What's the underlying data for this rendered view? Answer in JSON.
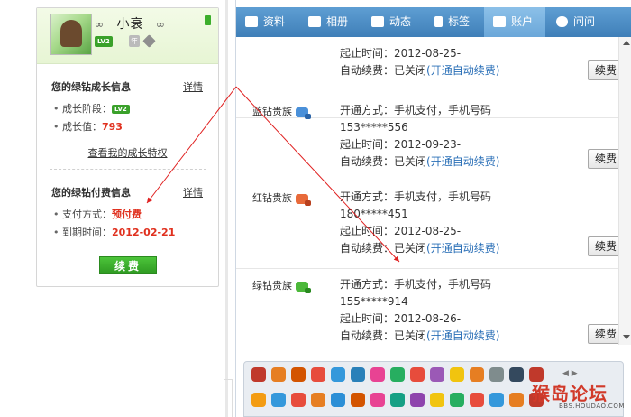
{
  "profile": {
    "nickname": "小衰",
    "nick_symbol": "∞",
    "level_badge": "LV2",
    "year_badge": "年"
  },
  "growth": {
    "title": "您的绿钻成长信息",
    "detail_link": "详情",
    "stage_label": "成长阶段：",
    "stage_badge": "LV2",
    "value_label": "成长值：",
    "value": "793",
    "privilege_link": "查看我的成长特权"
  },
  "payment": {
    "title": "您的绿钻付费信息",
    "detail_link": "详情",
    "method_label": "支付方式：",
    "method_value": "预付费",
    "expire_label": "到期时间：",
    "expire_value": "2012-02-21",
    "renew_button": "续费"
  },
  "tabs": [
    {
      "label": "资料",
      "icon": "id-card-icon"
    },
    {
      "label": "相册",
      "icon": "photo-album-icon"
    },
    {
      "label": "动态",
      "icon": "news-feed-icon"
    },
    {
      "label": "标签",
      "icon": "tag-icon"
    },
    {
      "label": "账户",
      "icon": "account-icon",
      "active": true
    },
    {
      "label": "问问",
      "icon": "question-icon"
    }
  ],
  "top_partial": {
    "masked_line": "--- ---",
    "period_label": "起止时间：",
    "period_value": "2012-08-25-",
    "auto_label": "自动续费：",
    "auto_value": "已关闭",
    "auto_link": "(开通自动续费)",
    "button": "续费"
  },
  "services": [
    {
      "name": "蓝钻贵族",
      "color": "blue",
      "open_label": "开通方式：",
      "open_value": "手机支付，手机号码",
      "phone": "153*****556",
      "period_label": "起止时间：",
      "period_value": "2012-09-23-",
      "auto_label": "自动续费：",
      "auto_value": "已关闭",
      "auto_link": "(开通自动续费)",
      "button": "续费"
    },
    {
      "name": "红钻贵族",
      "color": "red",
      "open_label": "开通方式：",
      "open_value": "手机支付，手机号码",
      "phone": "180*****451",
      "period_label": "起止时间：",
      "period_value": "2012-08-25-",
      "auto_label": "自动续费：",
      "auto_value": "已关闭",
      "auto_link": "(开通自动续费)",
      "button": "续费"
    },
    {
      "name": "绿钻贵族",
      "color": "green",
      "open_label": "开通方式：",
      "open_value": "手机支付，手机号码",
      "phone": "155*****914",
      "period_label": "起止时间：",
      "period_value": "2012-08-26-",
      "auto_label": "自动续费：",
      "auto_value": "已关闭",
      "auto_link": "(开通自动续费)",
      "button": "续费"
    }
  ],
  "watermark": {
    "main": "猴岛论坛",
    "sub": "BBS.HOUDAO.COM"
  },
  "colors": {
    "tab_bar": "#4a8bc4",
    "accent_green": "#3aa12a",
    "alert_red": "#e0301e",
    "link_blue": "#2a6fb7"
  }
}
